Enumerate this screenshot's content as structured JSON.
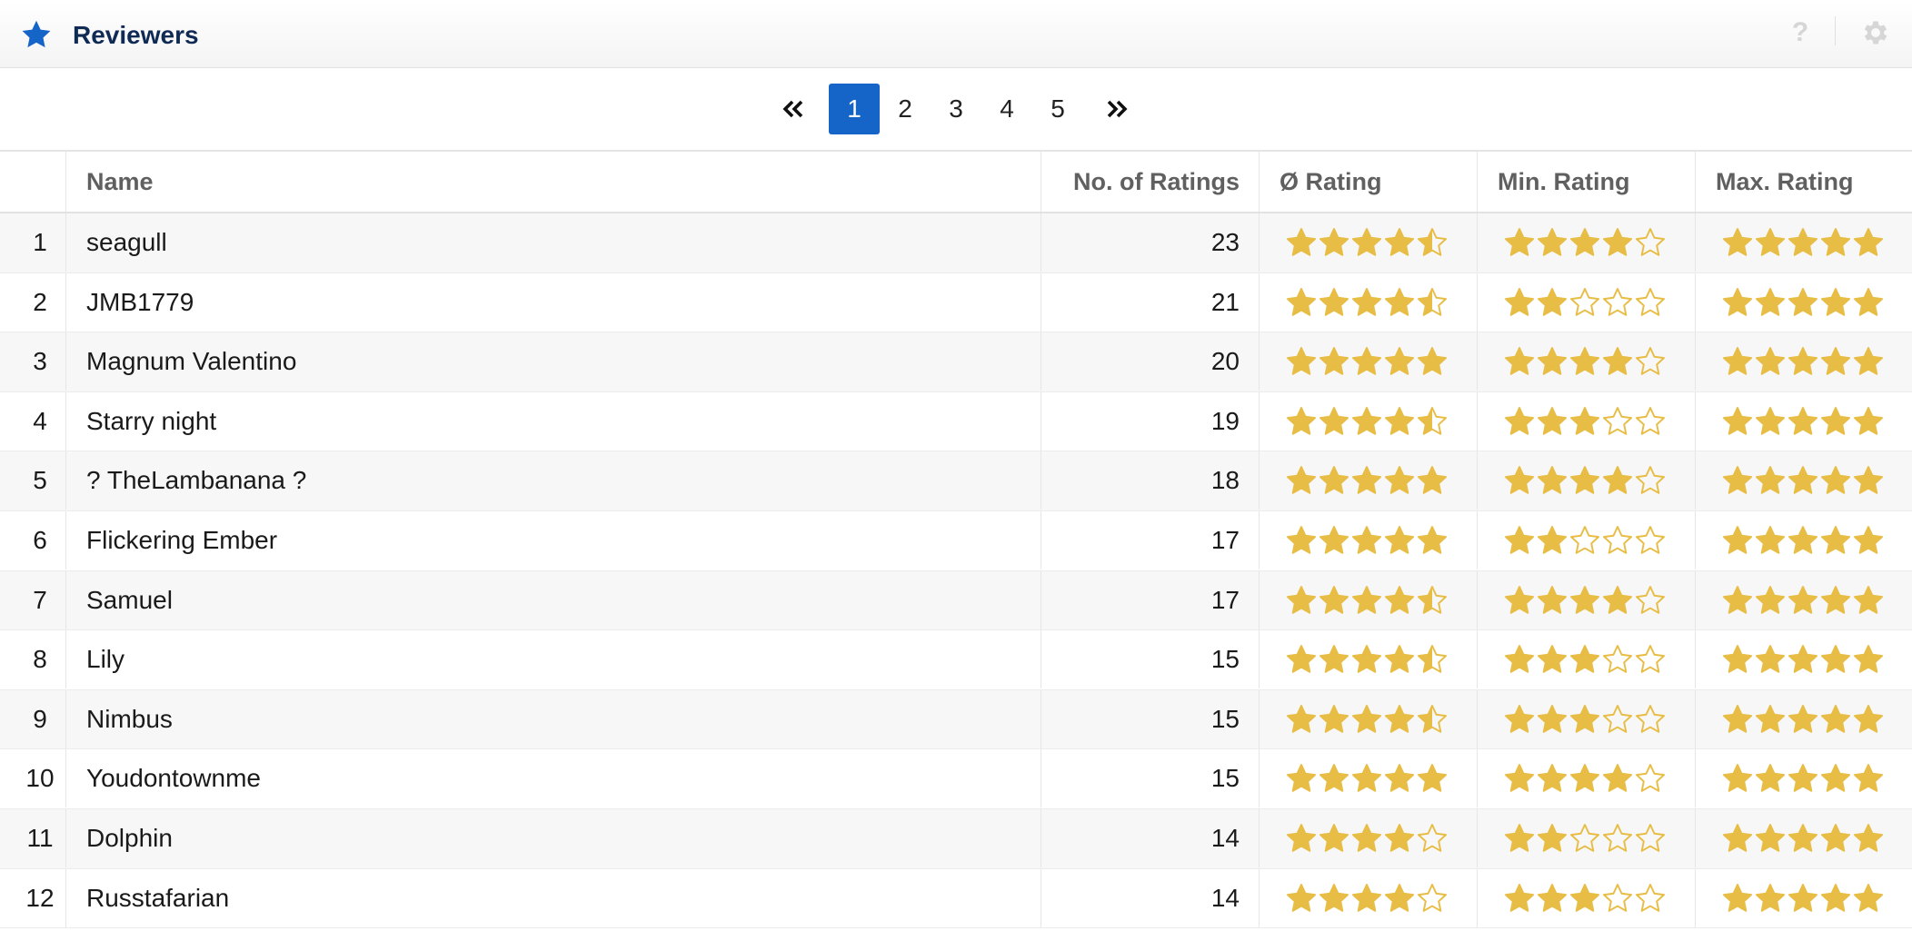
{
  "header": {
    "title": "Reviewers",
    "icon": "star-icon",
    "help_label": "?",
    "settings_icon": "gear-icon",
    "accent_color": "#1565c8",
    "title_color": "#0f2a55"
  },
  "pagination": {
    "first_icon": "double-chevron-left-icon",
    "last_icon": "double-chevron-right-icon",
    "pages": [
      "1",
      "2",
      "3",
      "4",
      "5"
    ],
    "current_page": "1"
  },
  "table": {
    "columns": {
      "name": "Name",
      "num_ratings": "No. of Ratings",
      "avg_rating": "Ø Rating",
      "min_rating": "Min. Rating",
      "max_rating": "Max. Rating"
    },
    "star_color": "#e8bd45",
    "rows": [
      {
        "index": "1",
        "name": "seagull",
        "num_ratings": "23",
        "avg": 4.5,
        "min": 4,
        "max": 5
      },
      {
        "index": "2",
        "name": "JMB1779",
        "num_ratings": "21",
        "avg": 4.5,
        "min": 2,
        "max": 5
      },
      {
        "index": "3",
        "name": "Magnum Valentino",
        "num_ratings": "20",
        "avg": 5,
        "min": 4,
        "max": 5
      },
      {
        "index": "4",
        "name": "Starry night",
        "num_ratings": "19",
        "avg": 4.5,
        "min": 3,
        "max": 5
      },
      {
        "index": "5",
        "name": "? TheLambanana ?",
        "num_ratings": "18",
        "avg": 5,
        "min": 4,
        "max": 5
      },
      {
        "index": "6",
        "name": "Flickering Ember",
        "num_ratings": "17",
        "avg": 5,
        "min": 2,
        "max": 5
      },
      {
        "index": "7",
        "name": "Samuel",
        "num_ratings": "17",
        "avg": 4.5,
        "min": 4,
        "max": 5
      },
      {
        "index": "8",
        "name": "Lily",
        "num_ratings": "15",
        "avg": 4.5,
        "min": 3,
        "max": 5
      },
      {
        "index": "9",
        "name": "Nimbus",
        "num_ratings": "15",
        "avg": 4.5,
        "min": 3,
        "max": 5
      },
      {
        "index": "10",
        "name": "Youdontownme",
        "num_ratings": "15",
        "avg": 5,
        "min": 4,
        "max": 5
      },
      {
        "index": "11",
        "name": "Dolphin",
        "num_ratings": "14",
        "avg": 4,
        "min": 2,
        "max": 5
      },
      {
        "index": "12",
        "name": "Russtafarian",
        "num_ratings": "14",
        "avg": 4,
        "min": 3,
        "max": 5
      }
    ]
  }
}
